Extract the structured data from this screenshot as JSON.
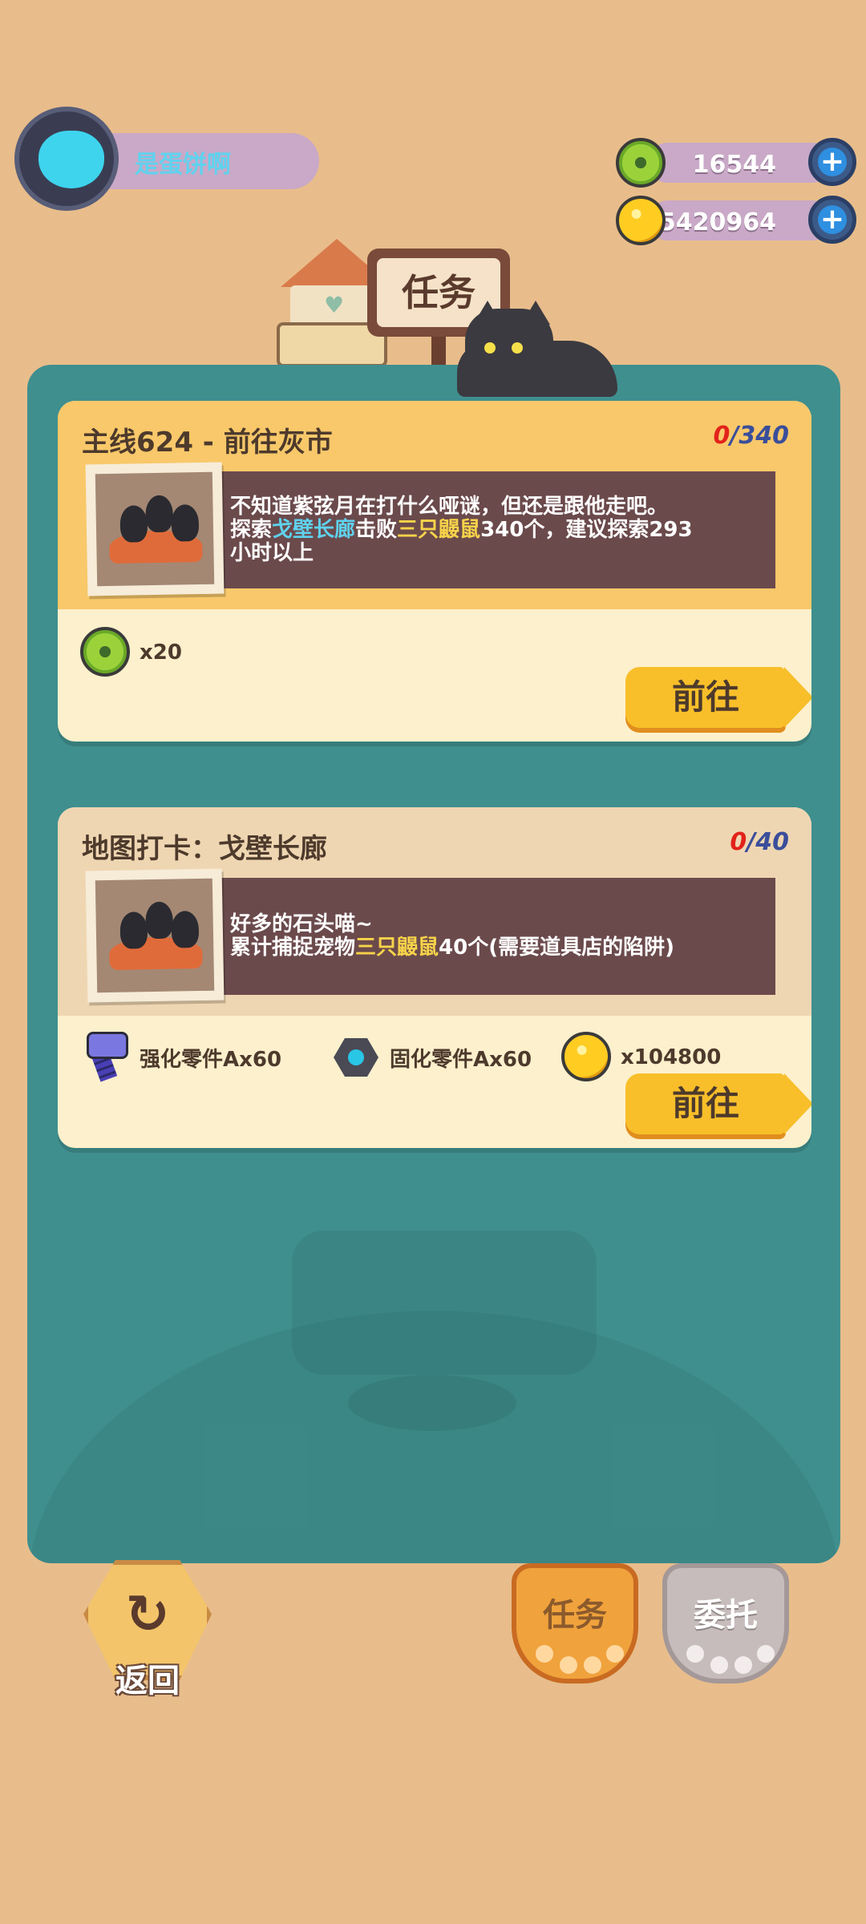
{
  "player": {
    "name": "是蛋饼啊"
  },
  "currencies": [
    {
      "icon": "green-donut-coin-icon",
      "value": "16544",
      "plus": "+"
    },
    {
      "icon": "gold-coin-icon",
      "value": "5420964",
      "plus": "+"
    }
  ],
  "header": {
    "sign_label": "任务"
  },
  "tasks": [
    {
      "title": "主线624 - 前往灰市",
      "progress_current": "0",
      "progress_total": "/340",
      "desc_line1": "不知道紫弦月在打什么哑谜，但还是跟他走吧。",
      "desc_line2_a": "探索",
      "desc_line2_place": "戈壁长廊",
      "desc_line2_b": "击败",
      "desc_line2_target": "三只鼹鼠",
      "desc_line2_c": "340个，建议探索293",
      "desc_line3": "小时以上",
      "rewards": [
        {
          "icon": "green-donut-coin-icon",
          "label": "x20"
        }
      ],
      "go_label": "前往"
    },
    {
      "title": "地图打卡：戈壁长廊",
      "progress_current": "0",
      "progress_total": "/40",
      "desc_line1": "好多的石头喵~",
      "desc_line2_a": "累计捕捉宠物",
      "desc_line2_target": "三只鼹鼠",
      "desc_line2_c": "40个(需要道具店的陷阱)",
      "rewards": [
        {
          "icon": "bolt-icon",
          "label": "强化零件Ax60"
        },
        {
          "icon": "nut-icon",
          "label": "固化零件Ax60"
        },
        {
          "icon": "gold-coin-icon",
          "label": "x104800"
        }
      ],
      "go_label": "前往"
    }
  ],
  "bottom": {
    "back_label": "返回",
    "tabs": [
      {
        "label": "任务",
        "active": true
      },
      {
        "label": "委托",
        "active": false
      }
    ]
  },
  "colors": {
    "background": "#e8bd8b",
    "panel": "#3f8f8e",
    "card": "#fdf0cc",
    "card_header": "#f8c86a",
    "desc_box": "#6b4a4c",
    "highlight_place": "#5fd2ee",
    "highlight_target": "#f7d34a",
    "go_button": "#f8bf2a",
    "progress_current": "#e2221a",
    "progress_total": "#3a4e9a"
  }
}
